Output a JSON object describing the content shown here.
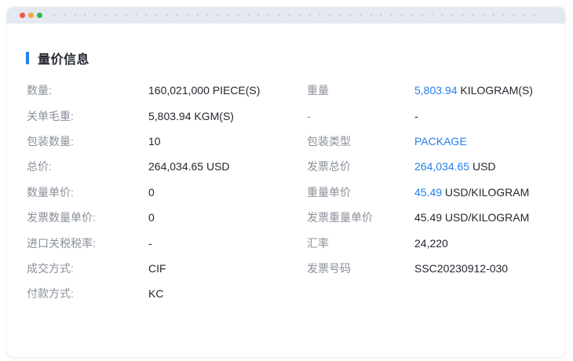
{
  "window": {
    "traffic_lights": [
      {
        "name": "close",
        "color": "#f3544d"
      },
      {
        "name": "minimize",
        "color": "#f2a63d"
      },
      {
        "name": "maximize",
        "color": "#30b94d"
      }
    ],
    "titlebar_bg": "#e4e8f0",
    "dot_pattern_color": "#c8cedb"
  },
  "section": {
    "title": "量价信息",
    "accent_color": "#2680eb"
  },
  "fields": {
    "left": [
      {
        "label": "数量:",
        "parts": [
          {
            "text": "160,021,000 PIECE(S)",
            "highlight": false
          }
        ]
      },
      {
        "label": "关单毛重:",
        "parts": [
          {
            "text": "5,803.94 KGM(S)",
            "highlight": false
          }
        ]
      },
      {
        "label": "包装数量:",
        "parts": [
          {
            "text": "10",
            "highlight": false
          }
        ]
      },
      {
        "label": "总价:",
        "parts": [
          {
            "text": "264,034.65 USD",
            "highlight": false
          }
        ]
      },
      {
        "label": "数量单价:",
        "parts": [
          {
            "text": "0",
            "highlight": false
          }
        ]
      },
      {
        "label": "发票数量单价:",
        "parts": [
          {
            "text": "0",
            "highlight": false
          }
        ]
      },
      {
        "label": "进口关税税率:",
        "parts": [
          {
            "text": "-",
            "highlight": false
          }
        ]
      },
      {
        "label": "成交方式:",
        "parts": [
          {
            "text": "CIF",
            "highlight": false
          }
        ]
      },
      {
        "label": "付款方式:",
        "parts": [
          {
            "text": "KC",
            "highlight": false
          }
        ]
      }
    ],
    "right": [
      {
        "label": "重量",
        "parts": [
          {
            "text": "5,803.94",
            "highlight": true
          },
          {
            "text": " KILOGRAM(S)",
            "highlight": false
          }
        ]
      },
      {
        "label": "-",
        "parts": [
          {
            "text": "-",
            "highlight": false
          }
        ]
      },
      {
        "label": "包装类型",
        "parts": [
          {
            "text": "PACKAGE",
            "highlight": true
          }
        ]
      },
      {
        "label": "发票总价",
        "parts": [
          {
            "text": "264,034.65",
            "highlight": true
          },
          {
            "text": " USD",
            "highlight": false
          }
        ]
      },
      {
        "label": "重量单价",
        "parts": [
          {
            "text": "45.49",
            "highlight": true
          },
          {
            "text": " USD/KILOGRAM",
            "highlight": false
          }
        ]
      },
      {
        "label": "发票重量单价",
        "parts": [
          {
            "text": "45.49 USD/KILOGRAM",
            "highlight": false
          }
        ]
      },
      {
        "label": "汇率",
        "parts": [
          {
            "text": "24,220",
            "highlight": false
          }
        ]
      },
      {
        "label": "发票号码",
        "parts": [
          {
            "text": "SSC20230912-030",
            "highlight": false
          }
        ]
      }
    ]
  }
}
